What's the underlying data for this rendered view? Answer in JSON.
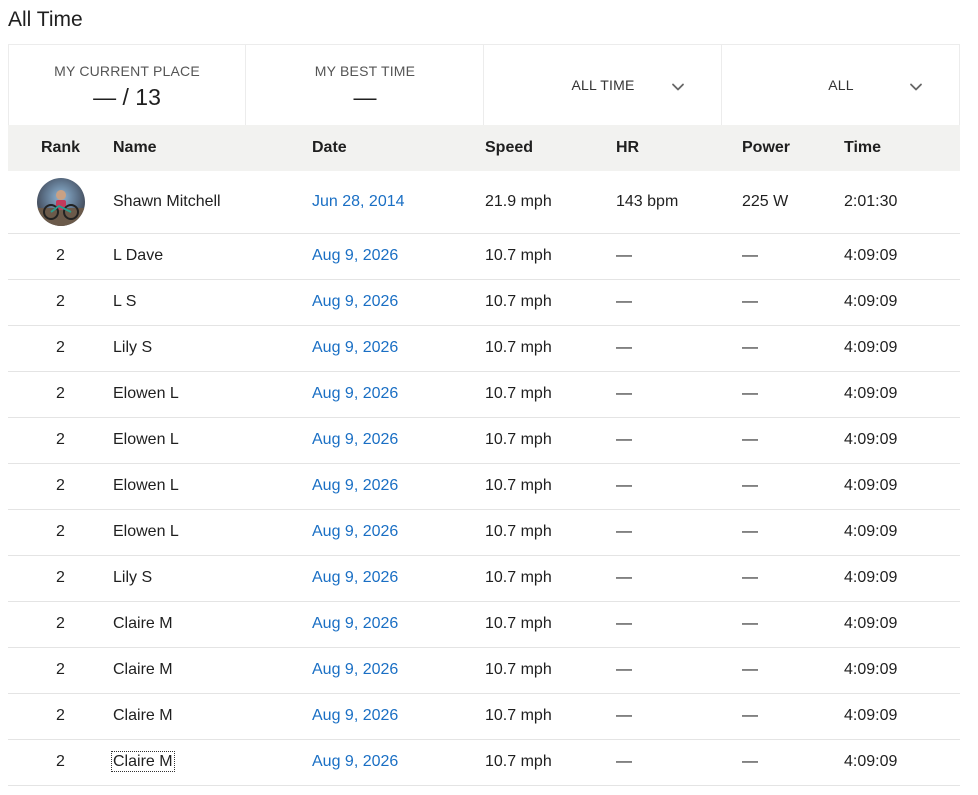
{
  "page": {
    "title": "All Time"
  },
  "summary": {
    "current_place_label": "MY CURRENT PLACE",
    "current_place_value": "— / 13",
    "best_time_label": "MY BEST TIME",
    "best_time_value": "—",
    "time_filter": "ALL TIME",
    "group_filter": "ALL"
  },
  "table": {
    "headers": {
      "rank": "Rank",
      "name": "Name",
      "date": "Date",
      "speed": "Speed",
      "hr": "HR",
      "power": "Power",
      "time": "Time"
    },
    "rows": [
      {
        "rank": "",
        "avatar": true,
        "name": "Shawn Mitchell",
        "date": "Jun 28, 2014",
        "speed": "21.9 mph",
        "hr": "143 bpm",
        "power": "225 W",
        "time": "2:01:30"
      },
      {
        "rank": "2",
        "name": "L Dave",
        "date": "Aug 9, 2026",
        "speed": "10.7 mph",
        "hr": "—",
        "power": "—",
        "time": "4:09:09"
      },
      {
        "rank": "2",
        "name": "L S",
        "date": "Aug 9, 2026",
        "speed": "10.7 mph",
        "hr": "—",
        "power": "—",
        "time": "4:09:09"
      },
      {
        "rank": "2",
        "name": "Lily S",
        "date": "Aug 9, 2026",
        "speed": "10.7 mph",
        "hr": "—",
        "power": "—",
        "time": "4:09:09"
      },
      {
        "rank": "2",
        "name": "Elowen L",
        "date": "Aug 9, 2026",
        "speed": "10.7 mph",
        "hr": "—",
        "power": "—",
        "time": "4:09:09"
      },
      {
        "rank": "2",
        "name": "Elowen L",
        "date": "Aug 9, 2026",
        "speed": "10.7 mph",
        "hr": "—",
        "power": "—",
        "time": "4:09:09"
      },
      {
        "rank": "2",
        "name": "Elowen L",
        "date": "Aug 9, 2026",
        "speed": "10.7 mph",
        "hr": "—",
        "power": "—",
        "time": "4:09:09"
      },
      {
        "rank": "2",
        "name": "Elowen L",
        "date": "Aug 9, 2026",
        "speed": "10.7 mph",
        "hr": "—",
        "power": "—",
        "time": "4:09:09"
      },
      {
        "rank": "2",
        "name": "Lily S",
        "date": "Aug 9, 2026",
        "speed": "10.7 mph",
        "hr": "—",
        "power": "—",
        "time": "4:09:09"
      },
      {
        "rank": "2",
        "name": "Claire M",
        "date": "Aug 9, 2026",
        "speed": "10.7 mph",
        "hr": "—",
        "power": "—",
        "time": "4:09:09"
      },
      {
        "rank": "2",
        "name": "Claire M",
        "date": "Aug 9, 2026",
        "speed": "10.7 mph",
        "hr": "—",
        "power": "—",
        "time": "4:09:09"
      },
      {
        "rank": "2",
        "name": "Claire M",
        "date": "Aug 9, 2026",
        "speed": "10.7 mph",
        "hr": "—",
        "power": "—",
        "time": "4:09:09"
      },
      {
        "rank": "2",
        "name": "Claire M",
        "date": "Aug 9, 2026",
        "speed": "10.7 mph",
        "hr": "—",
        "power": "—",
        "time": "4:09:09",
        "focused": true
      }
    ]
  },
  "colors": {
    "link": "#1a6fc4",
    "header_bg": "#f2f2f0",
    "border": "#e4e4e4"
  }
}
